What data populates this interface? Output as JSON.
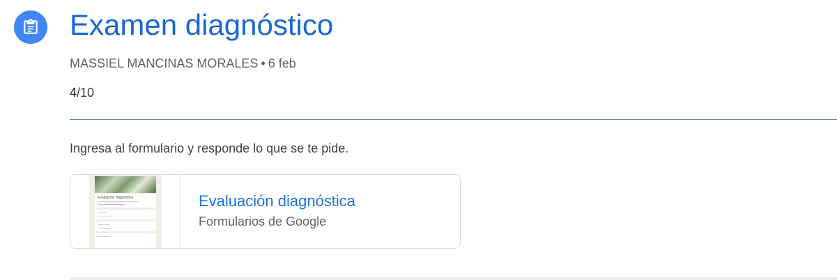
{
  "assignment": {
    "icon": "assignment-icon",
    "title": "Examen diagnóstico",
    "author": "MASSIEL MANCINAS MORALES",
    "separator": "•",
    "date": "6 feb",
    "score_earned": "4",
    "score_total": "/10",
    "instructions": "Ingresa al formulario y responde lo que se te pide."
  },
  "attachment": {
    "title": "Evaluación diagnóstica",
    "subtitle": "Formularios de Google",
    "thumbnail_title": "Evaluación diagnóstica"
  },
  "colors": {
    "accent": "#1967d2",
    "icon_bg": "#4285f4",
    "link": "#1a73e8",
    "divider": "#5b8c92"
  }
}
